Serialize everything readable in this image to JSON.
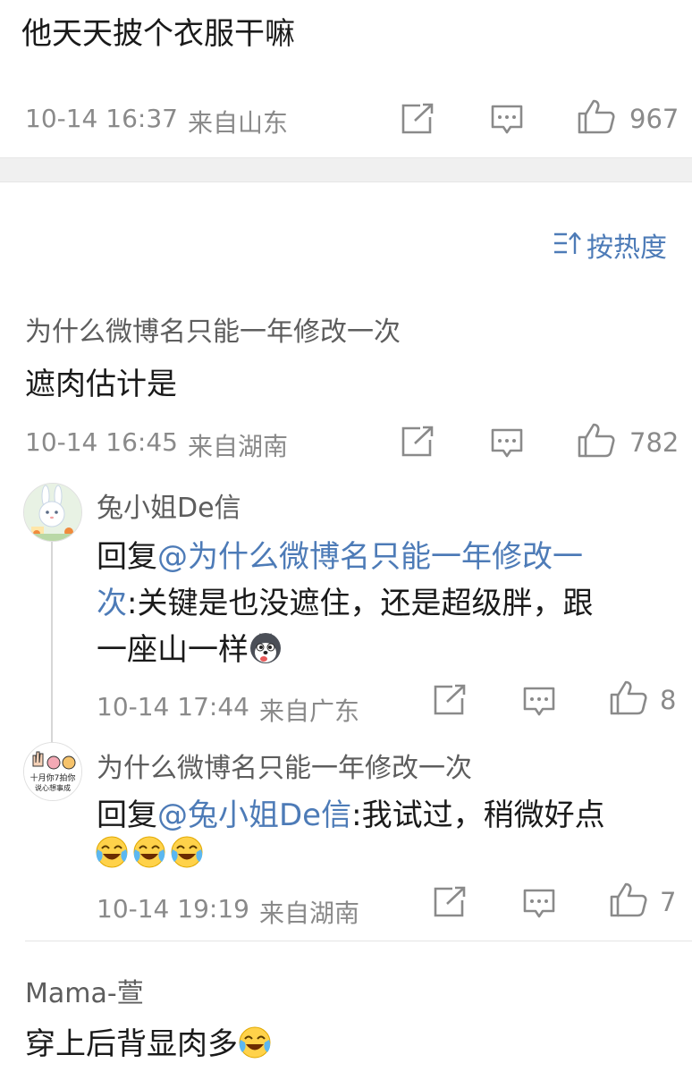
{
  "post": {
    "text": "他天天披个衣服干嘛",
    "time": "10-14 16:37",
    "location": "来自山东",
    "likes": "967"
  },
  "sort": {
    "label": "按热度"
  },
  "comments": [
    {
      "user": "为什么微博名只能一年修改一次",
      "text": "遮肉估计是",
      "time": "10-14 16:45",
      "location": "来自湖南",
      "likes": "782",
      "replies": [
        {
          "user": "兔小姐De信",
          "prefix": "回复",
          "mention": "@为什么微博名只能一年修改一",
          "mention_cont": "次",
          "line2_rest": ":关键是也没遮住，还是超级胖，跟",
          "line3": "一座山一样",
          "emoji": "husky-emoji",
          "time": "10-14 17:44",
          "location": "来自广东",
          "likes": "8"
        },
        {
          "user": "为什么微博名只能一年修改一次",
          "prefix": "回复",
          "mention": "@兔小姐De信",
          "rest": ":我试过，稍微好点",
          "emoji": "laugh-cry-emoji",
          "time": "10-14 19:19",
          "location": "来自湖南",
          "likes": "7"
        }
      ]
    },
    {
      "user": "Mama-萱",
      "text": "穿上后背显肉多",
      "emoji": "laugh-cry-emoji"
    }
  ],
  "colors": {
    "link": "#4d7bb7",
    "meta": "#8a8a8a",
    "divider": "#f0f0f0"
  }
}
